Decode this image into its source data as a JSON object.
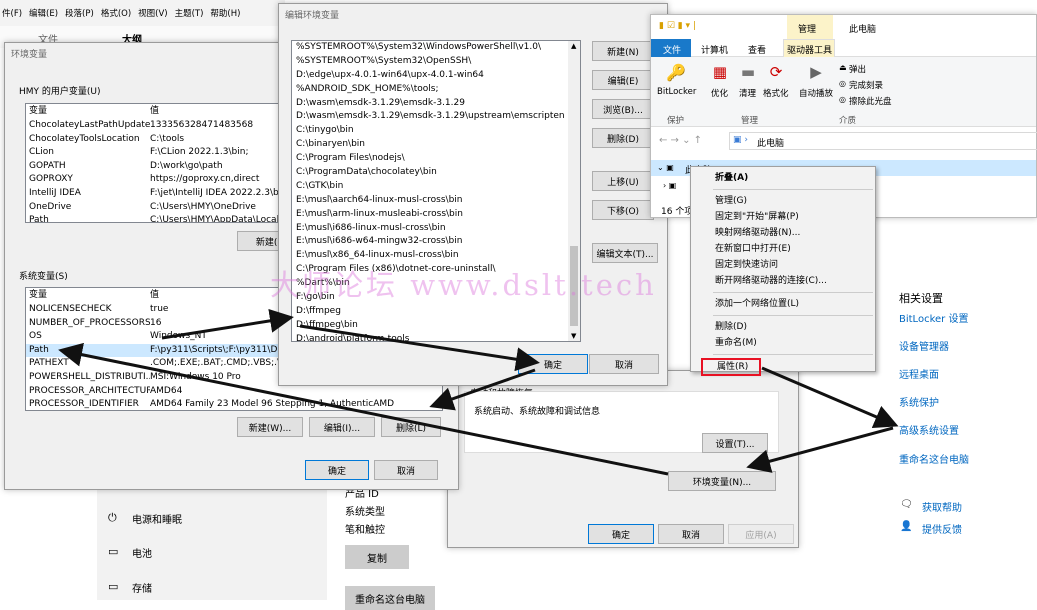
{
  "word_bar": {
    "menus": [
      "件(F)",
      "编辑(E)",
      "段落(P)",
      "格式(O)",
      "视图(V)",
      "主题(T)",
      "帮助(H)"
    ],
    "tab_file": "文件",
    "tab_outline": "大纲"
  },
  "env_dialog": {
    "title": "环境变量",
    "user_group": "HMY 的用户变量(U)",
    "col_var": "变量",
    "col_val": "值",
    "user_vars": [
      {
        "k": "ChocolateyLastPathUpdate",
        "v": "133356328471483568"
      },
      {
        "k": "ChocolateyToolsLocation",
        "v": "C:\\tools"
      },
      {
        "k": "CLion",
        "v": "F:\\CLion 2022.1.3\\bin;"
      },
      {
        "k": "GOPATH",
        "v": "D:\\work\\go\\path"
      },
      {
        "k": "GOPROXY",
        "v": "https://goproxy.cn,direct"
      },
      {
        "k": "IntelliJ IDEA",
        "v": "F:\\jet\\IntelliJ IDEA 2022.2.3\\bin"
      },
      {
        "k": "OneDrive",
        "v": "C:\\Users\\HMY\\OneDrive"
      },
      {
        "k": "Path",
        "v": "C:\\Users\\HMY\\AppData\\Local\\..."
      }
    ],
    "user_new": "新建(N",
    "sys_group": "系统变量(S)",
    "sys_vars": [
      {
        "k": "NOLICENSECHECK",
        "v": "true"
      },
      {
        "k": "NUMBER_OF_PROCESSORS",
        "v": "16"
      },
      {
        "k": "OS",
        "v": "Windows_NT"
      },
      {
        "k": "Path",
        "v": "F:\\py311\\Scripts\\;F:\\py311\\D:\\..."
      },
      {
        "k": "PATHEXT",
        "v": ".COM;.EXE;.BAT;.CMD;.VBS;.VB"
      },
      {
        "k": "POWERSHELL_DISTRIBUTI...",
        "v": "MSI:Windows 10 Pro"
      },
      {
        "k": "PROCESSOR_ARCHITECTURE",
        "v": "AMD64"
      },
      {
        "k": "PROCESSOR_IDENTIFIER",
        "v": "AMD64 Family 23 Model 96 Stepping 1, AuthenticAMD"
      }
    ],
    "sys_new": "新建(W)...",
    "sys_edit": "编辑(I)...",
    "sys_delete": "删除(L)",
    "ok": "确定",
    "cancel": "取消"
  },
  "edit_dialog": {
    "title": "编辑环境变量",
    "paths": [
      "%SYSTEMROOT%\\System32\\WindowsPowerShell\\v1.0\\",
      "%SYSTEMROOT%\\System32\\OpenSSH\\",
      "D:\\edge\\upx-4.0.1-win64\\upx-4.0.1-win64",
      "%ANDROID_SDK_HOME%\\tools;",
      "D:\\wasm\\emsdk-3.1.29\\emsdk-3.1.29",
      "D:\\wasm\\emsdk-3.1.29\\emsdk-3.1.29\\upstream\\emscripten",
      "C:\\tinygo\\bin",
      "C:\\binaryen\\bin",
      "C:\\Program Files\\nodejs\\",
      "C:\\ProgramData\\chocolatey\\bin",
      "C:\\GTK\\bin",
      "E:\\musl\\aarch64-linux-musl-cross\\bin",
      "E:\\musl\\arm-linux-musleabi-cross\\bin",
      "E:\\musl\\i686-linux-musl-cross\\bin",
      "E:\\musl\\i686-w64-mingw32-cross\\bin",
      "E:\\musl\\x86_64-linux-musl-cross\\bin",
      "C:\\Program Files (x86)\\dotnet-core-uninstall\\",
      "%Dart%\\bin",
      "F:\\go\\bin",
      "D:\\ffmpeg",
      "D:\\ffmpeg\\bin",
      "D:\\android\\platform-tools"
    ],
    "btn_new": "新建(N)",
    "btn_edit": "编辑(E)",
    "btn_browse": "浏览(B)...",
    "btn_delete": "删除(D)",
    "btn_up": "上移(U)",
    "btn_down": "下移(O)",
    "btn_edit_text": "编辑文本(T)...",
    "ok": "确定",
    "cancel": "取消"
  },
  "sys_props": {
    "startup_title": "启动和故障恢复",
    "startup_desc": "系统启动、系统故障和调试信息",
    "settings": "设置(T)...",
    "env_vars": "环境变量(N)...",
    "ok": "确定",
    "cancel": "取消",
    "apply": "应用(A)"
  },
  "explorer": {
    "tab_manage": "管理",
    "tab_thispc": "此电脑",
    "tabs": [
      "文件",
      "计算机",
      "查看",
      "驱动器工具"
    ],
    "ribbon": {
      "bitlocker": "BitLocker",
      "optimize": "优化",
      "cleanup": "清理",
      "format": "格式化",
      "autoplay": "自动播放",
      "eject": "弹出",
      "finish_burn": "完成刻录",
      "erase_disc": "擦除此光盘",
      "grp_protect": "保护",
      "grp_manage": "管理",
      "grp_media": "介质"
    },
    "address": "此电脑",
    "status": "16 个项",
    "tree_item": "此电脑"
  },
  "context_menu": {
    "items": [
      "折叠(A)",
      "管理(G)",
      "固定到\"开始\"屏幕(P)",
      "映射网络驱动器(N)...",
      "在新窗口中打开(E)",
      "固定到快速访问",
      "断开网络驱动器的连接(C)...",
      "添加一个网络位置(L)",
      "删除(D)",
      "重命名(M)",
      "属性(R)"
    ]
  },
  "settings_page": {
    "related_title": "相关设置",
    "links": [
      "BitLocker 设置",
      "设备管理器",
      "远程桌面",
      "系统保护",
      "高级系统设置",
      "重命名这台电脑"
    ],
    "help": "获取帮助",
    "feedback": "提供反馈",
    "side_items": [
      "电源和睡眠",
      "电池",
      "存储"
    ],
    "spec_labels": [
      "产品 ID",
      "系统类型",
      "笔和触控"
    ],
    "copy": "复制",
    "rename_pc": "重命名这台电脑"
  },
  "watermark": "大师论坛  www.dslt.tech",
  "colors": {
    "accent": "#0078d7",
    "link": "#0067c0",
    "highlight_red": "#e81123"
  }
}
